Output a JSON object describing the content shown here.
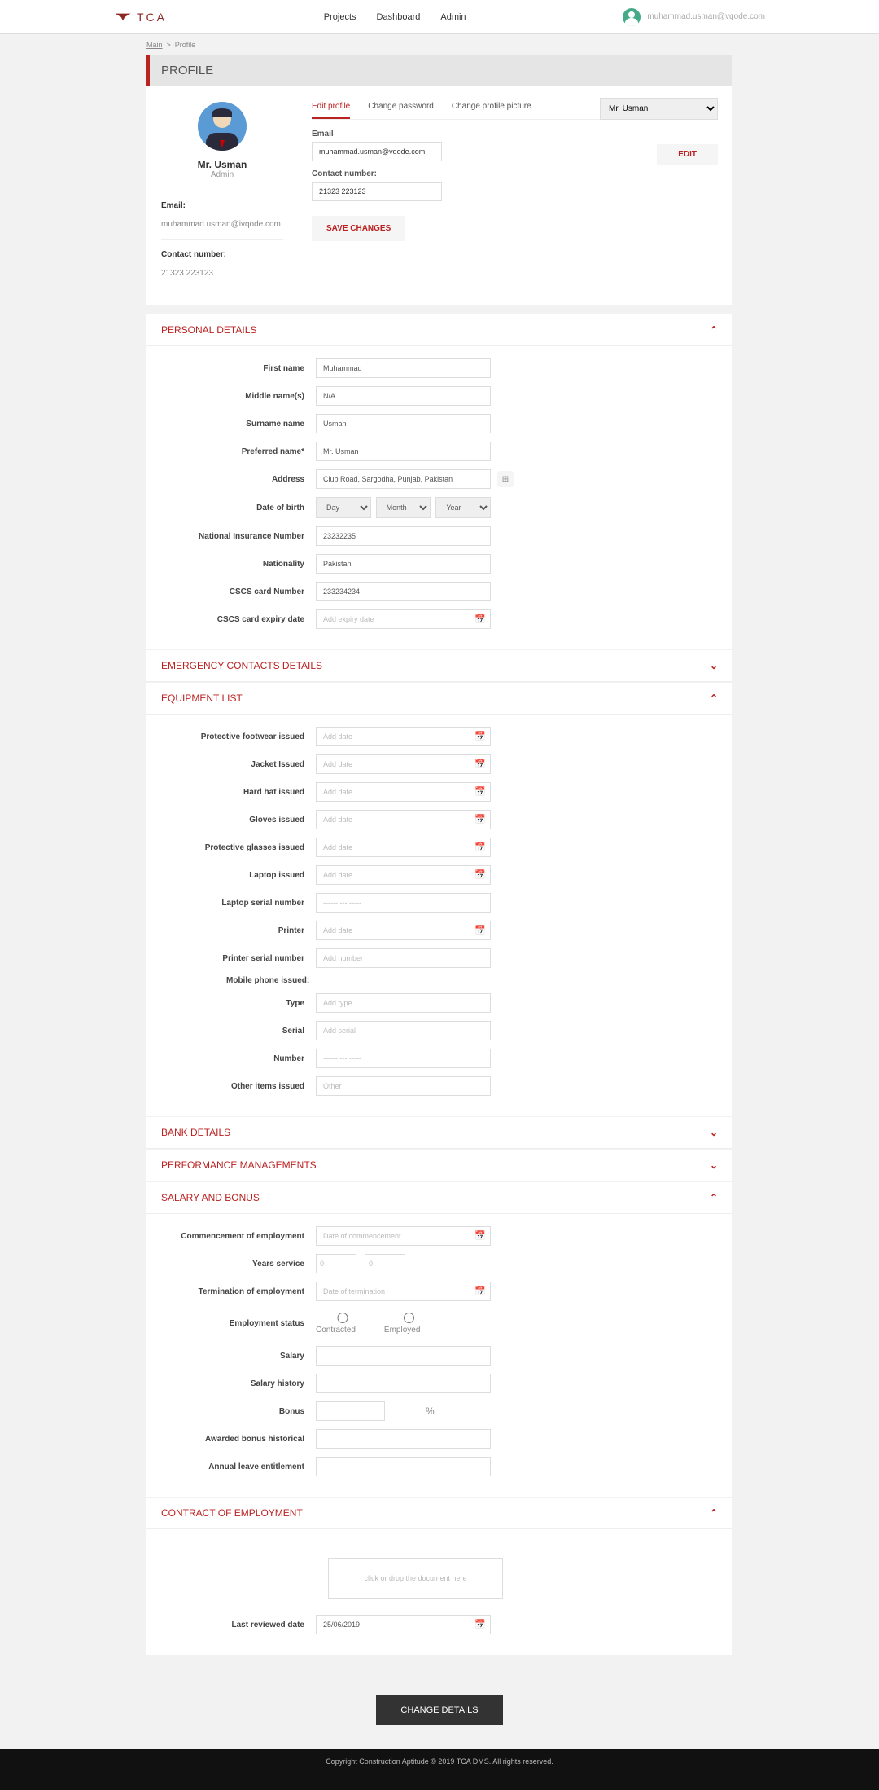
{
  "brand": "TCA",
  "nav": {
    "projects": "Projects",
    "dashboard": "Dashboard",
    "admin": "Admin"
  },
  "user_email_header": "muhammad.usman@vqode.com",
  "breadcrumb": {
    "main": "Main",
    "profile": "Profile"
  },
  "page_title": "PROFILE",
  "profile": {
    "name": "Mr. Usman",
    "role": "Admin",
    "email_label": "Email:",
    "email": "muhammad.usman@ivqode.com",
    "contact_label": "Contact number:",
    "contact": "21323 223123"
  },
  "tabs": {
    "edit": "Edit profile",
    "pw": "Change password",
    "pic": "Change profile picture"
  },
  "dropdown_val": "Mr. Usman",
  "edit_btn": "EDIT",
  "form": {
    "email_label": "Email",
    "email_value": "muhammad.usman@vqode.com",
    "contact_label": "Contact number:",
    "contact_value": "21323 223123",
    "save": "SAVE CHANGES"
  },
  "sections": {
    "personal": {
      "title": "PERSONAL DETAILS",
      "first_name_l": "First name",
      "first_name_v": "Muhammad",
      "middle_l": "Middle name(s)",
      "middle_v": "N/A",
      "surname_l": "Surname name",
      "surname_v": "Usman",
      "pref_l": "Preferred name*",
      "pref_v": "Mr. Usman",
      "address_l": "Address",
      "address_v": "Club Road, Sargodha, Punjab, Pakistan",
      "dob_l": "Date of birth",
      "dob_day": "Day",
      "dob_month": "Month",
      "dob_year": "Year",
      "nin_l": "National Insurance Number",
      "nin_v": "23232235",
      "nat_l": "Nationality",
      "nat_v": "Pakistani",
      "cscs_l": "CSCS card Number",
      "cscs_v": "233234234",
      "cscs_exp_l": "CSCS card expiry date",
      "cscs_exp_ph": "Add expiry date"
    },
    "emergency": {
      "title": "EMERGENCY CONTACTS DETAILS"
    },
    "equipment": {
      "title": "EQUIPMENT LIST",
      "add_date": "Add date",
      "foot_l": "Protective footwear issued",
      "jacket_l": "Jacket Issued",
      "hat_l": "Hard hat issued",
      "gloves_l": "Gloves issued",
      "glasses_l": "Protective glasses issued",
      "laptop_l": "Laptop issued",
      "laptop_sn_l": "Laptop serial number",
      "laptop_sn_ph": "------ --- -----",
      "printer_l": "Printer",
      "printer_sn_l": "Printer serial number",
      "printer_sn_ph": "Add number",
      "mobile_head": "Mobile phone issued:",
      "type_l": "Type",
      "type_ph": "Add type",
      "serial_l": "Serial",
      "serial_ph": "Add serial",
      "number_l": "Number",
      "number_ph": "------ --- -----",
      "other_l": "Other items issued",
      "other_ph": "Other"
    },
    "bank": {
      "title": "BANK DETAILS"
    },
    "perf": {
      "title": "PERFORMANCE MANAGEMENTS"
    },
    "salary": {
      "title": "SALARY AND BONUS",
      "comm_l": "Commencement of employment",
      "comm_ph": "Date of commencement",
      "years_l": "Years service",
      "years_ph": "0",
      "term_l": "Termination of employment",
      "term_ph": "Date of termination",
      "status_l": "Employment status",
      "contracted": "Contracted",
      "employed": "Employed",
      "salary_l": "Salary",
      "history_l": "Salary history",
      "bonus_l": "Bonus",
      "bonus_pct": "%",
      "awarded_l": "Awarded bonus historical",
      "leave_l": "Annual leave entitlement"
    },
    "contract": {
      "title": "CONTRACT OF EMPLOYMENT",
      "dropzone": "click or drop the document here",
      "last_l": "Last reviewed date",
      "last_v": "25/06/2019"
    }
  },
  "change_details": "CHANGE DETAILS",
  "footer": "Copyright Construction Aptitude © 2019 TCA DMS. All rights reserved."
}
